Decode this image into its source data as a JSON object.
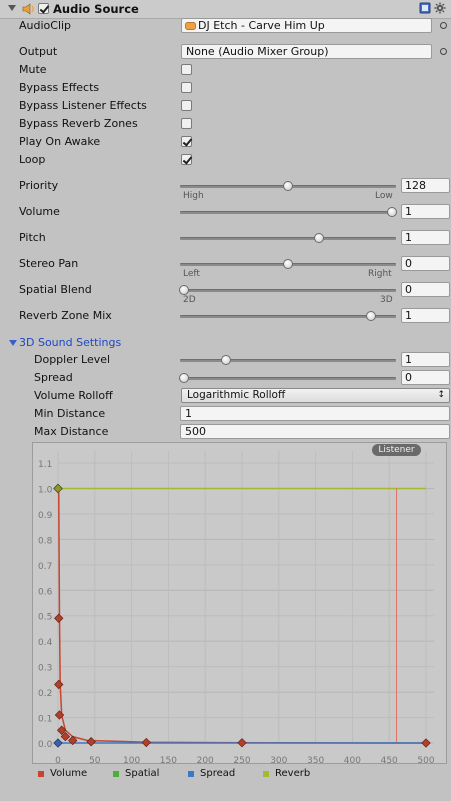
{
  "header": {
    "title": "Audio Source",
    "component_enabled": true,
    "icons": {
      "collapse": "triangle-down-icon",
      "speaker": "speaker-icon",
      "help": "help-book-icon",
      "settings": "gear-icon"
    }
  },
  "fields": {
    "audio_clip": {
      "label": "AudioClip",
      "value": "DJ Etch - Carve Him Up"
    },
    "output": {
      "label": "Output",
      "value": "None (Audio Mixer Group)"
    }
  },
  "toggles": [
    {
      "label": "Mute",
      "checked": false
    },
    {
      "label": "Bypass Effects",
      "checked": false
    },
    {
      "label": "Bypass Listener Effects",
      "checked": false
    },
    {
      "label": "Bypass Reverb Zones",
      "checked": false
    },
    {
      "label": "Play On Awake",
      "checked": true
    },
    {
      "label": "Loop",
      "checked": true
    }
  ],
  "sliders": [
    {
      "label": "Priority",
      "value": "128",
      "fraction": 0.5,
      "min_label": "High",
      "max_label": "Low"
    },
    {
      "label": "Volume",
      "value": "1",
      "fraction": 1.0
    },
    {
      "label": "Pitch",
      "value": "1",
      "fraction": 0.65
    },
    {
      "label": "Stereo Pan",
      "value": "0",
      "fraction": 0.5,
      "min_label": "Left",
      "max_label": "Right"
    },
    {
      "label": "Spatial Blend",
      "value": "0",
      "fraction": 0.0,
      "min_label": "2D",
      "max_label": "3D"
    },
    {
      "label": "Reverb Zone Mix",
      "value": "1",
      "fraction": 0.9
    }
  ],
  "sound3d": {
    "section_label": "3D Sound Settings",
    "doppler": {
      "label": "Doppler Level",
      "value": "1",
      "fraction": 0.2
    },
    "spread": {
      "label": "Spread",
      "value": "0",
      "fraction": 0.0
    },
    "rolloff": {
      "label": "Volume Rolloff",
      "value": "Logarithmic Rolloff"
    },
    "min_distance": {
      "label": "Min Distance",
      "value": "1"
    },
    "max_distance": {
      "label": "Max Distance",
      "value": "500"
    }
  },
  "graph": {
    "listener_label": "Listener",
    "y_ticks": [
      "1.1",
      "1.0",
      "0.9",
      "0.8",
      "0.7",
      "0.6",
      "0.5",
      "0.4",
      "0.3",
      "0.2",
      "0.1",
      "0.0"
    ],
    "x_ticks": [
      "0",
      "50",
      "100",
      "150",
      "200",
      "250",
      "300",
      "350",
      "400",
      "450",
      "500"
    ],
    "listener_distance": 460,
    "volume_curve": [
      [
        0,
        1.0
      ],
      [
        1,
        0.98
      ],
      [
        2,
        0.5
      ],
      [
        3,
        0.23
      ],
      [
        5,
        0.11
      ],
      [
        10,
        0.05
      ],
      [
        20,
        0.025
      ],
      [
        40,
        0.01
      ],
      [
        120,
        0.003
      ],
      [
        250,
        0.001
      ],
      [
        500,
        0.0
      ]
    ],
    "reverb_level": 1.0,
    "colors": {
      "volume": "#c8442c",
      "spatial": "#4caf3c",
      "spread": "#3a78c8",
      "reverb": "#a8b832"
    },
    "legend": [
      "Volume",
      "Spatial",
      "Spread",
      "Reverb"
    ]
  }
}
